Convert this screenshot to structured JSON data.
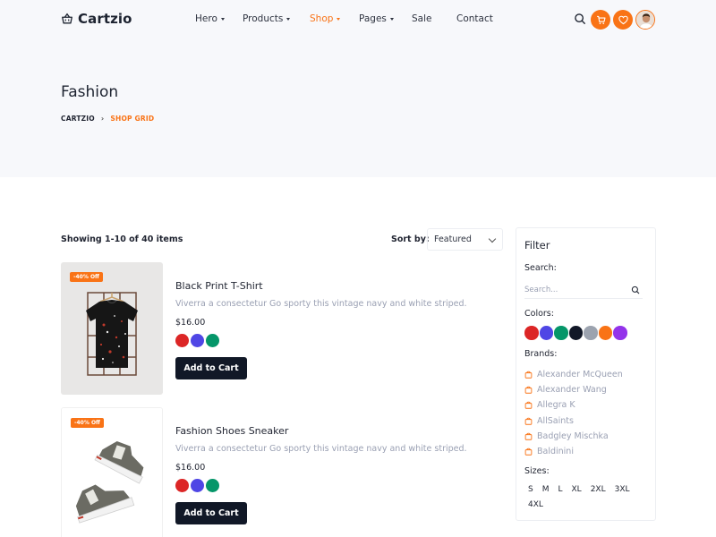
{
  "header": {
    "logo_text": "Cartzio",
    "nav": [
      {
        "label": "Hero",
        "has_caret": true,
        "active": false
      },
      {
        "label": "Products",
        "has_caret": true,
        "active": false
      },
      {
        "label": "Shop",
        "has_caret": true,
        "active": true
      },
      {
        "label": "Pages",
        "has_caret": true,
        "active": false
      },
      {
        "label": "Sale",
        "has_caret": false,
        "active": false
      },
      {
        "label": "Contact",
        "has_caret": false,
        "active": false
      }
    ],
    "icons": [
      "search-icon",
      "cart-icon",
      "heart-icon",
      "avatar"
    ]
  },
  "hero": {
    "title": "Fashion",
    "breadcrumb_home": "CARTZIO",
    "breadcrumb_separator": "›",
    "breadcrumb_current": "SHOP GRID"
  },
  "toolbar": {
    "showing": "Showing 1-10 of 40 items",
    "sort_label": "Sort by:",
    "sort_value": "Featured"
  },
  "products": [
    {
      "badge": "-40% Off",
      "name": "Black Print T-Shirt",
      "description": "Viverra a consectetur Go sporty this vintage navy and white striped.",
      "price": "$16.00",
      "swatches": [
        "#dc2626",
        "#4f46e5",
        "#059669"
      ],
      "button": "Add to Cart"
    },
    {
      "badge": "-40% Off",
      "name": "Fashion Shoes Sneaker",
      "description": "Viverra a consectetur Go sporty this vintage navy and white striped.",
      "price": "$16.00",
      "swatches": [
        "#dc2626",
        "#4f46e5",
        "#059669"
      ],
      "button": "Add to Cart"
    }
  ],
  "filter": {
    "title": "Filter",
    "search_label": "Search:",
    "search_placeholder": "Search...",
    "colors_label": "Colors:",
    "colors": [
      "#dc2626",
      "#4f46e5",
      "#059669",
      "#111827",
      "#9ca3af",
      "#f97316",
      "#9333ea"
    ],
    "brands_label": "Brands:",
    "brands": [
      "Alexander McQueen",
      "Alexander Wang",
      "Allegra K",
      "AllSaints",
      "Badgley Mischka",
      "Baldinini"
    ],
    "sizes_label": "Sizes:",
    "sizes": [
      "S",
      "M",
      "L",
      "XL",
      "2XL",
      "3XL",
      "4XL"
    ]
  },
  "colors": {
    "accent": "#f97316",
    "dark": "#111827",
    "muted": "#9aa0b3"
  }
}
